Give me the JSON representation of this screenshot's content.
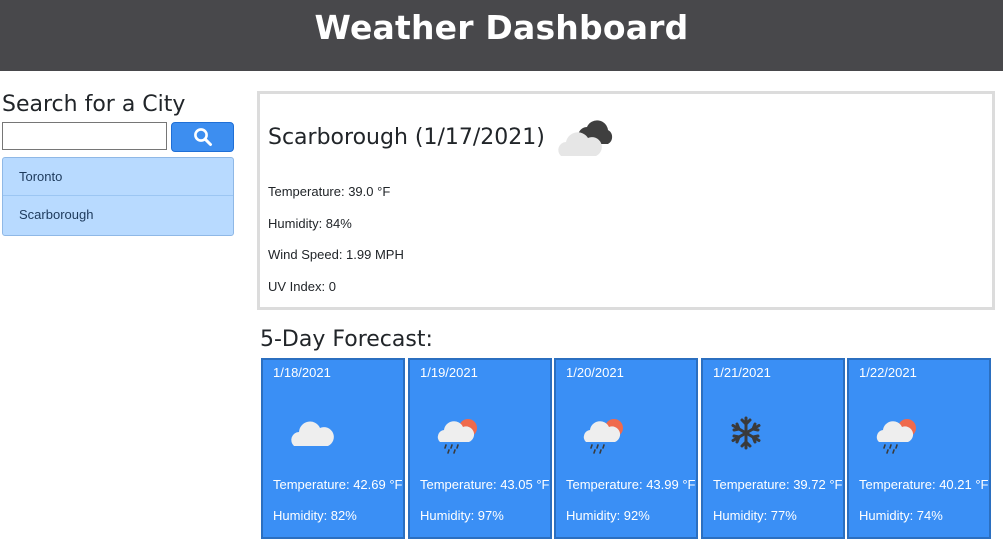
{
  "header": {
    "title": "Weather Dashboard"
  },
  "search": {
    "heading": "Search for a City",
    "value": "",
    "placeholder": "",
    "button_icon": "search-icon"
  },
  "history": [
    "Toronto",
    "Scarborough"
  ],
  "current": {
    "title": "Scarborough (1/17/2021)",
    "icon": "cloudy-icon",
    "temperature": "Temperature: 39.0 °F",
    "humidity": "Humidity: 84%",
    "wind": "Wind Speed: 1.99 MPH",
    "uv": "UV Index: 0"
  },
  "forecast": {
    "title": "5-Day Forecast:",
    "days": [
      {
        "date": "1/18/2021",
        "icon": "cloud-icon",
        "temperature": "Temperature: 42.69 °F",
        "humidity": "Humidity: 82%"
      },
      {
        "date": "1/19/2021",
        "icon": "rain-sun-icon",
        "temperature": "Temperature: 43.05 °F",
        "humidity": "Humidity: 97%"
      },
      {
        "date": "1/20/2021",
        "icon": "rain-sun-icon",
        "temperature": "Temperature: 43.99 °F",
        "humidity": "Humidity: 92%"
      },
      {
        "date": "1/21/2021",
        "icon": "snowflake-icon",
        "temperature": "Temperature: 39.72 °F",
        "humidity": "Humidity: 77%"
      },
      {
        "date": "1/22/2021",
        "icon": "rain-sun-icon",
        "temperature": "Temperature: 40.21 °F",
        "humidity": "Humidity: 74%"
      }
    ]
  },
  "colors": {
    "header_bg": "#48484b",
    "card_bg": "#3a8ff5",
    "button_bg": "#3d8ef0",
    "history_bg": "#b8daff"
  }
}
